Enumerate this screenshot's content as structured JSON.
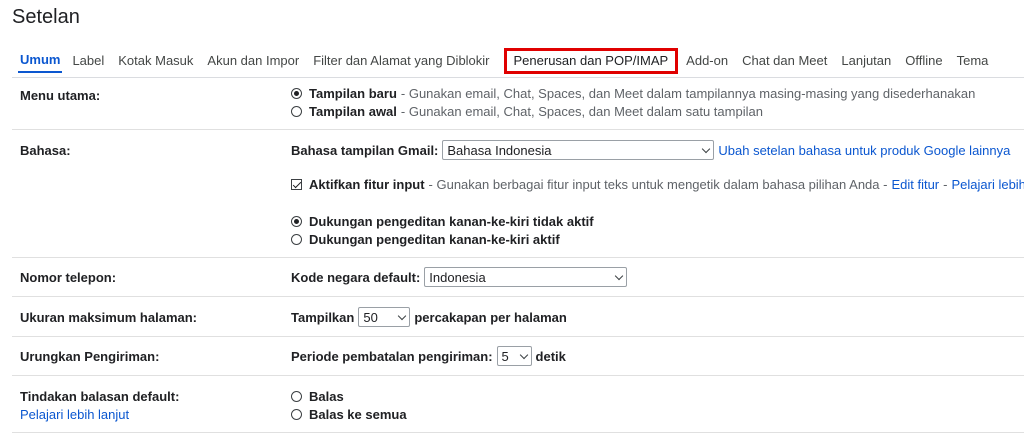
{
  "page": {
    "title": "Setelan"
  },
  "tabs": [
    {
      "label": "Umum"
    },
    {
      "label": "Label"
    },
    {
      "label": "Kotak Masuk"
    },
    {
      "label": "Akun dan Impor"
    },
    {
      "label": "Filter dan Alamat yang Diblokir"
    },
    {
      "label": "Penerusan dan POP/IMAP"
    },
    {
      "label": "Add-on"
    },
    {
      "label": "Chat dan Meet"
    },
    {
      "label": "Lanjutan"
    },
    {
      "label": "Offline"
    },
    {
      "label": "Tema"
    }
  ],
  "menu_utama": {
    "label": "Menu utama:",
    "new_title": "Tampilan baru",
    "new_desc": "- Gunakan email, Chat, Spaces, dan Meet dalam tampilannya masing-masing yang disederhanakan",
    "old_title": "Tampilan awal",
    "old_desc": "- Gunakan email, Chat, Spaces, dan Meet dalam satu tampilan"
  },
  "bahasa": {
    "label": "Bahasa:",
    "display_label": "Bahasa tampilan Gmail:",
    "display_value": "Bahasa Indonesia",
    "change_link": "Ubah setelan bahasa untuk produk Google lainnya",
    "input_title": "Aktifkan fitur input",
    "input_desc": "- Gunakan berbagai fitur input teks untuk mengetik dalam bahasa pilihan Anda -",
    "edit_link": "Edit fitur",
    "learn_link": "Pelajari lebih la",
    "rtl_off": "Dukungan pengeditan kanan-ke-kiri tidak aktif",
    "rtl_on": "Dukungan pengeditan kanan-ke-kiri aktif"
  },
  "telepon": {
    "label": "Nomor telepon:",
    "country_label": "Kode negara default:",
    "country_value": "Indonesia"
  },
  "ukuran": {
    "label": "Ukuran maksimum halaman:",
    "show": "Tampilkan",
    "value": "50",
    "suffix": "percakapan per halaman"
  },
  "urungkan": {
    "label": "Urungkan Pengiriman:",
    "period_label": "Periode pembatalan pengiriman:",
    "value": "5",
    "suffix": "detik"
  },
  "balasan": {
    "label": "Tindakan balasan default:",
    "learn_link": "Pelajari lebih lanjut",
    "reply": "Balas",
    "reply_all": "Balas ke semua"
  },
  "colors": {
    "accent": "#0b57d0",
    "highlight": "#e00000"
  }
}
